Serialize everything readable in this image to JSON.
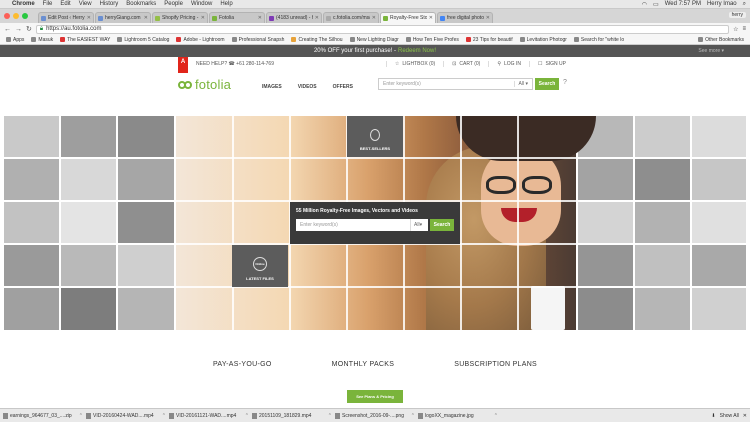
{
  "menubar": {
    "apple": "",
    "app": "Chrome",
    "items": [
      "File",
      "Edit",
      "View",
      "History",
      "Bookmarks",
      "People",
      "Window",
      "Help"
    ],
    "clock": "Wed 7:57 PM",
    "user": "Herry Imao"
  },
  "tabs": [
    {
      "title": "Edit Post ‹ Herry Tjiang —",
      "active": false
    },
    {
      "title": "herryGiang.com Site Overv",
      "active": false
    },
    {
      "title": "Shopify Pricing - The Bes",
      "active": false
    },
    {
      "title": "Fotolia",
      "active": false
    },
    {
      "title": "(4183 unread) - herryGao",
      "active": false
    },
    {
      "title": "c.fotolia.com/ms/ab0e/9ebc",
      "active": false
    },
    {
      "title": "Royalty-Free Stock Photos",
      "active": true
    },
    {
      "title": "free digital photo net - Go",
      "active": false
    }
  ],
  "profile": "herry",
  "address": {
    "url": "https://au.fotolia.com"
  },
  "bookmarks": {
    "items": [
      "Apps",
      "Masuk",
      "The EASIEST WAY",
      "Lightroom 5 Catalog",
      "Adobe - Lightroom",
      "Professional Snapsh",
      "Creating The Silhou",
      "New Lighting Diagr",
      "How Ten Five Profes",
      "23 Tips for beautif",
      "Levitation Photogr",
      "Search for \"white lo"
    ],
    "other": "Other Bookmarks"
  },
  "promo": {
    "text": "20% OFF your first purchase! -",
    "link": "Redeem Now!",
    "seemore": "See more ▾"
  },
  "header": {
    "adobe": "A",
    "help": "NEED HELP? ☎ +61 280-114-769",
    "lightbox": "LIGHTBOX (0)",
    "cart": "CART (0)",
    "login": "LOG IN",
    "signup": "SIGN UP",
    "logo": "fotolia",
    "nav": [
      "IMAGES",
      "VIDEOS",
      "OFFERS"
    ],
    "search_placeholder": "Enter keyword(s)",
    "search_select": "All",
    "search_button": "Search"
  },
  "hero": {
    "bestsellers": "BEST-SELLERS",
    "latest": "LATEST FILES",
    "latest_badge": "Online",
    "center_title": "55 Million Royalty-Free Images, Vectors and Videos",
    "center_placeholder": "Enter keyword(s)",
    "center_select": "All",
    "center_button": "Search"
  },
  "plans": [
    "PAY-AS-YOU-GO",
    "MONTHLY PACKS",
    "SUBSCRIPTION PLANS"
  ],
  "cta": "See Plans & Pricing",
  "downloads": [
    "earnings_964677_03_....zip",
    "VID-20160424-WAD....mp4",
    "VID-20161121-WAD....mp4",
    "20151109_181829.mp4",
    "Screenshot_2016-09-....png",
    "logoXX_magazine.jpg"
  ],
  "show_all": "Show All",
  "colors": {
    "brand_green": "#7ab43b",
    "promo_bg": "#555555",
    "adobe_red": "#e1251b"
  }
}
